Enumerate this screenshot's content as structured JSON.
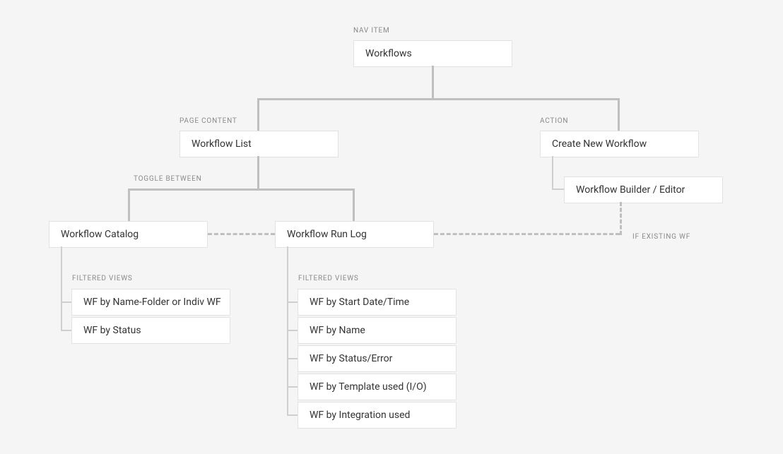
{
  "labels": {
    "nav_item": "NAV ITEM",
    "page_content": "PAGE CONTENT",
    "action": "ACTION",
    "toggle_between": "TOGGLE BETWEEN",
    "filtered_views_left": "FILTERED VIEWS",
    "filtered_views_right": "FILTERED VIEWS",
    "if_existing_wf": "IF EXISTING WF"
  },
  "nodes": {
    "workflows": "Workflows",
    "workflow_list": "Workflow List",
    "create_new_workflow": "Create New Workflow",
    "workflow_builder_editor": "Workflow Builder / Editor",
    "workflow_catalog": "Workflow Catalog",
    "workflow_run_log": "Workflow Run Log",
    "catalog_filters": [
      "WF by Name-Folder or Indiv WF",
      "WF by Status"
    ],
    "runlog_filters": [
      "WF by Start Date/Time",
      "WF by Name",
      "WF by Status/Error",
      "WF by Template used (I/O)",
      "WF by Integration used"
    ]
  }
}
